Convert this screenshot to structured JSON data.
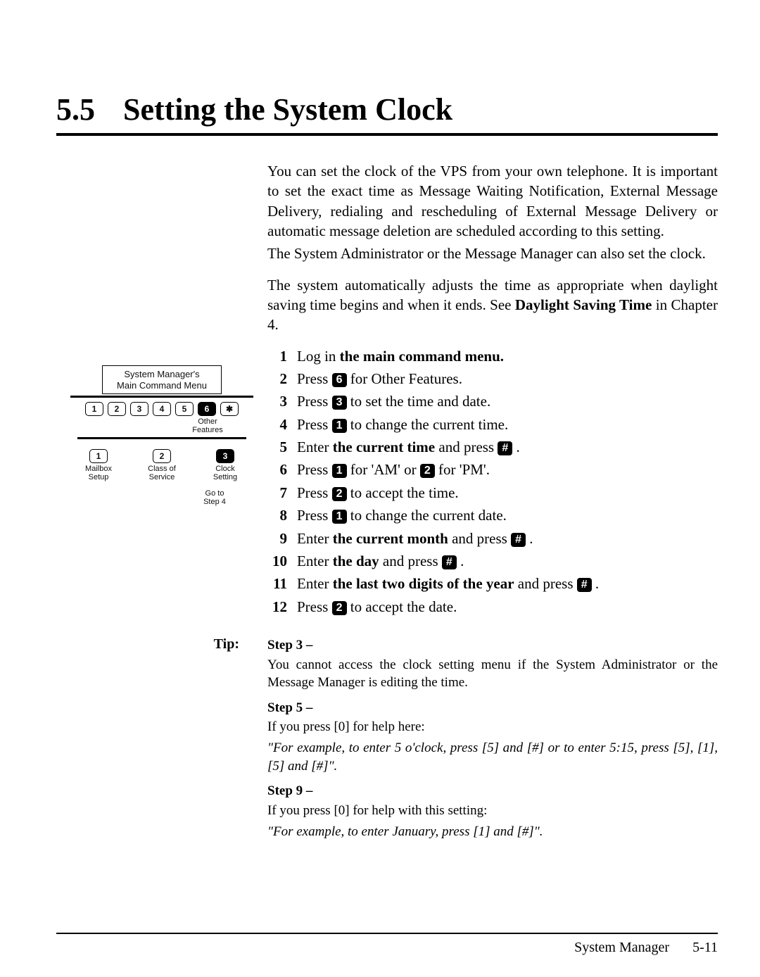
{
  "section_number": "5.5",
  "section_title": "Setting the System Clock",
  "intro_p1": "You can set the clock of the VPS from your own telephone. It is important to set the exact time as Message Waiting Notification, External Message Delivery, redialing and rescheduling of External Message Delivery or automatic message deletion are scheduled according to this setting.",
  "intro_p2": "The System Administrator or the Message Manager can also set the clock.",
  "intro_p3a": "The system automatically adjusts the time as appropriate when daylight saving time begins and when it ends. See ",
  "intro_p3_bold": "Daylight Saving Time",
  "intro_p3b": " in Chapter 4.",
  "steps": [
    {
      "n": "1",
      "pre": "Log in ",
      "bold": "the main command menu.",
      "post": ""
    },
    {
      "n": "2",
      "pre": "Press ",
      "key": "6",
      "post": " for Other Features."
    },
    {
      "n": "3",
      "pre": "Press ",
      "key": "3",
      "post": " to set the time and date."
    },
    {
      "n": "4",
      "pre": "Press ",
      "key": "1",
      "post": " to change the current time."
    },
    {
      "n": "5",
      "pre": "Enter ",
      "bold": "the current time",
      "mid": " and press ",
      "key": "#",
      "post": " ."
    },
    {
      "n": "6",
      "pre": "Press ",
      "key": "1",
      "mid": " for 'AM' or ",
      "key2": "2",
      "post": " for 'PM'."
    },
    {
      "n": "7",
      "pre": "Press ",
      "key": "2",
      "post": " to accept the time."
    },
    {
      "n": "8",
      "pre": "Press ",
      "key": "1",
      "post": " to change the current date."
    },
    {
      "n": "9",
      "pre": "Enter ",
      "bold": "the current month",
      "mid": " and press ",
      "key": "#",
      "post": " ."
    },
    {
      "n": "10",
      "pre": "Enter ",
      "bold": "the day",
      "mid": " and press ",
      "key": "#",
      "post": " ."
    },
    {
      "n": "11",
      "pre": "Enter ",
      "bold": "the last two digits of the year",
      "mid": " and press ",
      "key": "#",
      "post": " ."
    },
    {
      "n": "12",
      "pre": "Press ",
      "key": "2",
      "post": " to accept the date."
    }
  ],
  "tip_label": "Tip:",
  "tips": {
    "t3_head": "Step 3 –",
    "t3_body": "You cannot access the clock setting menu if the System Administrator or the Message Manager is editing the time.",
    "t5_head": "Step 5 –",
    "t5_line1": "If you press [0] for help here:",
    "t5_italic": "\"For example, to enter 5 o'clock, press [5] and [#] or to enter 5:15, press [5], [1], [5] and [#]\".",
    "t9_head": "Step 9 –",
    "t9_line1": "If you press [0] for help with this setting:",
    "t9_italic": "\"For example, to enter January, press [1] and [#]\"."
  },
  "diagram": {
    "menu_title_line1": "System Manager's",
    "menu_title_line2": "Main Command Menu",
    "topkeys": [
      "1",
      "2",
      "3",
      "4",
      "5",
      "6",
      "✱"
    ],
    "other_features": "Other\nFeatures",
    "row2": [
      {
        "key": "1",
        "label": "Mailbox\nSetup",
        "solid": false
      },
      {
        "key": "2",
        "label": "Class of\nService",
        "solid": false
      },
      {
        "key": "3",
        "label": "Clock\nSetting",
        "solid": true
      }
    ],
    "goto": "Go to\nStep 4"
  },
  "footer_left": "System Manager",
  "footer_page": "5-11"
}
